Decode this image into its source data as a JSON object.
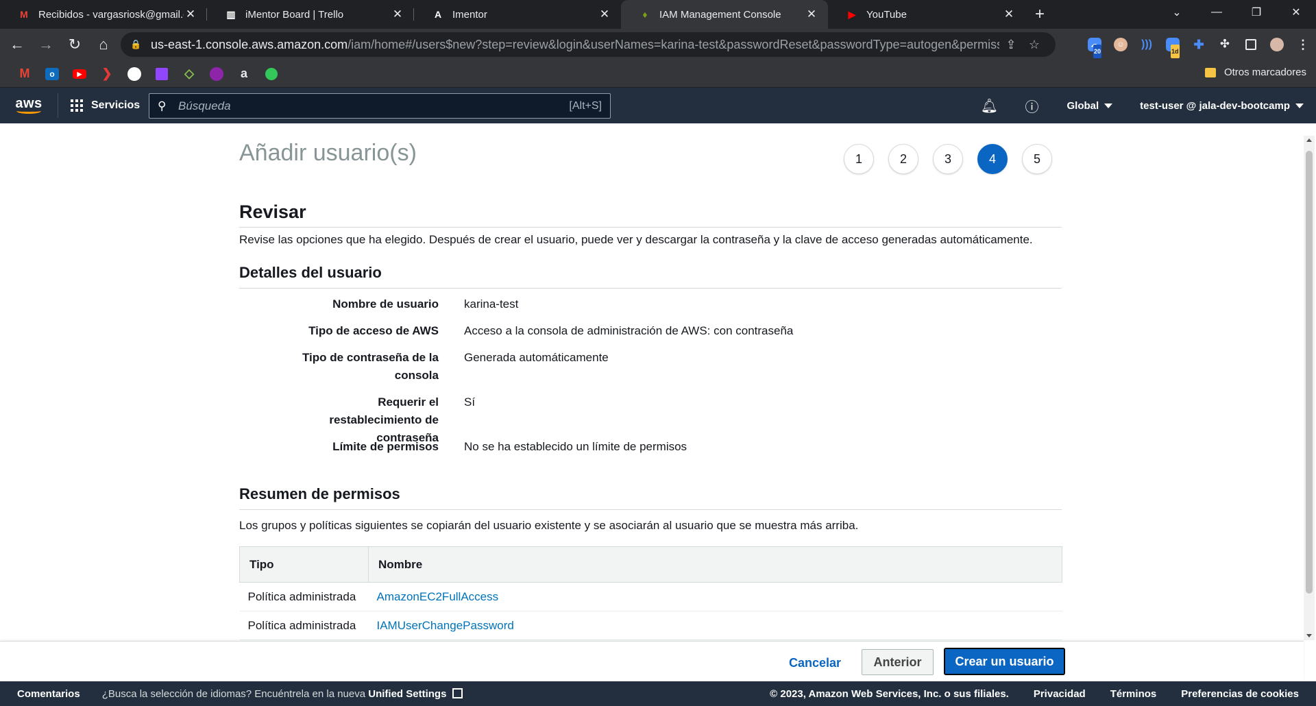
{
  "browser": {
    "tabs": [
      {
        "title": "Recibidos - vargasriosk@gmail.co",
        "favicon": "gmail-icon",
        "favicon_color": "#ea4335",
        "favicon_glyph": "M"
      },
      {
        "title": "iMentor Board | Trello",
        "favicon": "trello-icon",
        "favicon_color": "#ffffff",
        "favicon_glyph": "▥"
      },
      {
        "title": "Imentor",
        "favicon": "imentor-icon",
        "favicon_color": "#ffffff",
        "favicon_glyph": "A"
      },
      {
        "title": "IAM Management Console",
        "favicon": "aws-iam-icon",
        "favicon_color": "#7aa116",
        "favicon_glyph": "♦"
      },
      {
        "title": "YouTube",
        "favicon": "youtube-icon",
        "favicon_color": "#ff0000",
        "favicon_glyph": "▶"
      }
    ],
    "active_tab": 3,
    "url_host": "us-east-1.console.aws.amazon.com",
    "url_path": "/iam/home#/users$new?step=review&login&userNames=karina-test&passwordReset&passwordType=autogen&permissio...",
    "extension_badge_1": "20",
    "extension_badge_2": "1d",
    "other_bookmarks": "Otros marcadores"
  },
  "aws_header": {
    "logo_text": "aws",
    "services_label": "Servicios",
    "search_placeholder": "Búsqueda",
    "search_shortcut": "[Alt+S]",
    "region": "Global",
    "account": "test-user @ jala-dev-bootcamp"
  },
  "page": {
    "title": "Añadir usuario(s)",
    "steps": [
      "1",
      "2",
      "3",
      "4",
      "5"
    ],
    "active_step": 4,
    "review_title": "Revisar",
    "review_description": "Revise las opciones que ha elegido. Después de crear el usuario, puede ver y descargar la contraseña y la clave de acceso generadas automáticamente.",
    "user_details_title": "Detalles del usuario",
    "details": [
      {
        "label": "Nombre de usuario",
        "value": "karina-test"
      },
      {
        "label": "Tipo de acceso de AWS",
        "value": "Acceso a la consola de administración de AWS: con contraseña"
      },
      {
        "label": "Tipo de contraseña de la consola",
        "value": "Generada automáticamente"
      },
      {
        "label": "Requerir el restablecimiento de contraseña",
        "value": "Sí"
      },
      {
        "label": "Límite de permisos",
        "value": "No se ha establecido un límite de permisos"
      }
    ],
    "permissions_title": "Resumen de permisos",
    "permissions_description": "Los grupos y políticas siguientes se copiarán del usuario existente y se asociarán al usuario que se muestra más arriba.",
    "permissions_table": {
      "headers": [
        "Tipo",
        "Nombre"
      ],
      "rows": [
        {
          "type": "Política administrada",
          "name": "AmazonEC2FullAccess"
        },
        {
          "type": "Política administrada",
          "name": "IAMUserChangePassword"
        }
      ]
    }
  },
  "actions": {
    "cancel": "Cancelar",
    "previous": "Anterior",
    "create": "Crear un usuario"
  },
  "footer": {
    "feedback": "Comentarios",
    "language_prompt": "¿Busca la selección de idiomas? Encuéntrela en la nueva",
    "unified_settings": "Unified Settings",
    "copyright": "© 2023, Amazon Web Services, Inc. o sus filiales.",
    "privacy": "Privacidad",
    "terms": "Términos",
    "cookies": "Preferencias de cookies"
  },
  "colors": {
    "aws_nav": "#232f3e",
    "accent": "#0a66c2",
    "link": "#0073bb",
    "aws_orange": "#ff9900"
  }
}
